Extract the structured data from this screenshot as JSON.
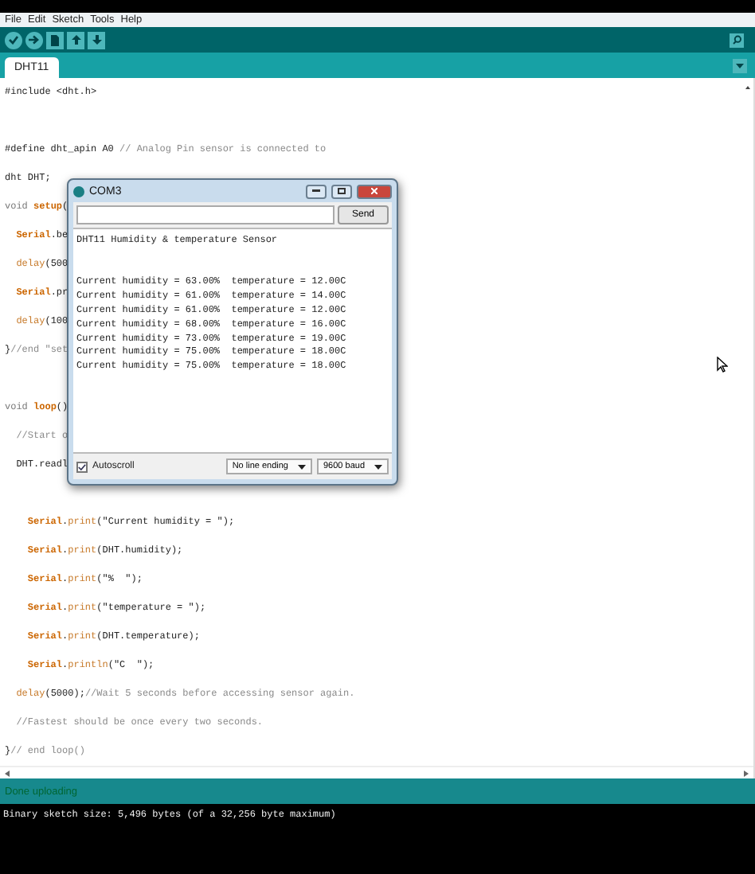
{
  "menu": [
    "File",
    "Edit",
    "Sketch",
    "Tools",
    "Help"
  ],
  "toolbar": [
    {
      "kind": "verify"
    },
    {
      "kind": "upload"
    },
    {
      "kind": "new"
    },
    {
      "kind": "open"
    },
    {
      "kind": "save"
    }
  ],
  "tabs": [
    {
      "label": "DHT11",
      "selected": true
    }
  ],
  "editor": {
    "blocks": [
      {
        "lines": [
          {
            "parts": [
              {
                "kind": "plain",
                "text": "#include <dht.h>"
              }
            ]
          }
        ]
      },
      {
        "lines": [
          {
            "parts": [
              {
                "kind": "plain",
                "text": "#define dht_apin A0 "
              },
              {
                "kind": "comment",
                "text": "// Analog Pin sensor is connected to"
              }
            ]
          },
          {
            "parts": [
              {
                "kind": "plain",
                "text": "dht DHT;"
              }
            ]
          },
          {
            "parts": [
              {
                "kind": "type",
                "text": "void "
              },
              {
                "kind": "keyword",
                "text": "setup"
              },
              {
                "kind": "plain",
                "text": "("
              }
            ]
          },
          {
            "parts": [
              {
                "kind": "keyword",
                "text": "  Serial"
              },
              {
                "kind": "plain",
                "text": ".be"
              }
            ]
          },
          {
            "parts": [
              {
                "kind": "function",
                "text": "  delay"
              },
              {
                "kind": "plain",
                "text": "(500"
              }
            ]
          },
          {
            "parts": [
              {
                "kind": "keyword",
                "text": "  Serial"
              },
              {
                "kind": "plain",
                "text": ".pr"
              }
            ]
          },
          {
            "parts": [
              {
                "kind": "function",
                "text": "  delay"
              },
              {
                "kind": "plain",
                "text": "(100"
              }
            ]
          },
          {
            "parts": [
              {
                "kind": "plain",
                "text": "}"
              },
              {
                "kind": "comment",
                "text": "//end \"set"
              }
            ]
          }
        ]
      },
      {
        "lines": [
          {
            "parts": [
              {
                "kind": "type",
                "text": "void "
              },
              {
                "kind": "keyword",
                "text": "loop"
              },
              {
                "kind": "plain",
                "text": "()"
              }
            ]
          },
          {
            "parts": [
              {
                "kind": "comment",
                "text": "  //Start o"
              }
            ]
          },
          {
            "parts": [
              {
                "kind": "plain",
                "text": "  DHT.readl"
              }
            ]
          }
        ]
      },
      {
        "lines": [
          {
            "parts": [
              {
                "kind": "keyword",
                "text": "    Serial"
              },
              {
                "kind": "plain",
                "text": "."
              },
              {
                "kind": "function",
                "text": "print"
              },
              {
                "kind": "plain",
                "text": "(\"Current humidity = \");"
              }
            ]
          },
          {
            "parts": [
              {
                "kind": "keyword",
                "text": "    Serial"
              },
              {
                "kind": "plain",
                "text": "."
              },
              {
                "kind": "function",
                "text": "print"
              },
              {
                "kind": "plain",
                "text": "(DHT.humidity);"
              }
            ]
          },
          {
            "parts": [
              {
                "kind": "keyword",
                "text": "    Serial"
              },
              {
                "kind": "plain",
                "text": "."
              },
              {
                "kind": "function",
                "text": "print"
              },
              {
                "kind": "plain",
                "text": "(\"%  \");"
              }
            ]
          },
          {
            "parts": [
              {
                "kind": "keyword",
                "text": "    Serial"
              },
              {
                "kind": "plain",
                "text": "."
              },
              {
                "kind": "function",
                "text": "print"
              },
              {
                "kind": "plain",
                "text": "(\"temperature = \");"
              }
            ]
          },
          {
            "parts": [
              {
                "kind": "keyword",
                "text": "    Serial"
              },
              {
                "kind": "plain",
                "text": "."
              },
              {
                "kind": "function",
                "text": "print"
              },
              {
                "kind": "plain",
                "text": "(DHT.temperature);"
              }
            ]
          },
          {
            "parts": [
              {
                "kind": "keyword",
                "text": "    Serial"
              },
              {
                "kind": "plain",
                "text": "."
              },
              {
                "kind": "function",
                "text": "println"
              },
              {
                "kind": "plain",
                "text": "(\"C  \");"
              }
            ]
          },
          {
            "parts": [
              {
                "kind": "function",
                "text": "  delay"
              },
              {
                "kind": "plain",
                "text": "(5000);"
              },
              {
                "kind": "comment",
                "text": "//Wait 5 seconds before accessing sensor again."
              }
            ]
          },
          {
            "parts": [
              {
                "kind": "comment",
                "text": "  //Fastest should be once every two seconds."
              }
            ]
          },
          {
            "parts": [
              {
                "kind": "plain",
                "text": "}"
              },
              {
                "kind": "comment",
                "text": "// end loop()"
              }
            ]
          }
        ]
      }
    ]
  },
  "serial_monitor": {
    "title": "COM3",
    "send_label": "Send",
    "output_header": "DHT11 Humidity & temperature Sensor",
    "output": [
      "Current humidity = 63.00%  temperature = 12.00C",
      "Current humidity = 61.00%  temperature = 14.00C",
      "Current humidity = 61.00%  temperature = 12.00C",
      "Current humidity = 68.00%  temperature = 16.00C",
      "Current humidity = 73.00%  temperature = 19.00C",
      "Current humidity = 75.00%  temperature = 18.00C",
      "Current humidity = 75.00%  temperature = 18.00C"
    ],
    "autoscroll": {
      "label": "Autoscroll",
      "checked": true
    },
    "line_ending": "No line ending",
    "baud": "9600 baud"
  },
  "status": "Done uploading",
  "console": [
    "Binary sketch size: 5,496 bytes (of a 32,256 byte maximum)"
  ]
}
